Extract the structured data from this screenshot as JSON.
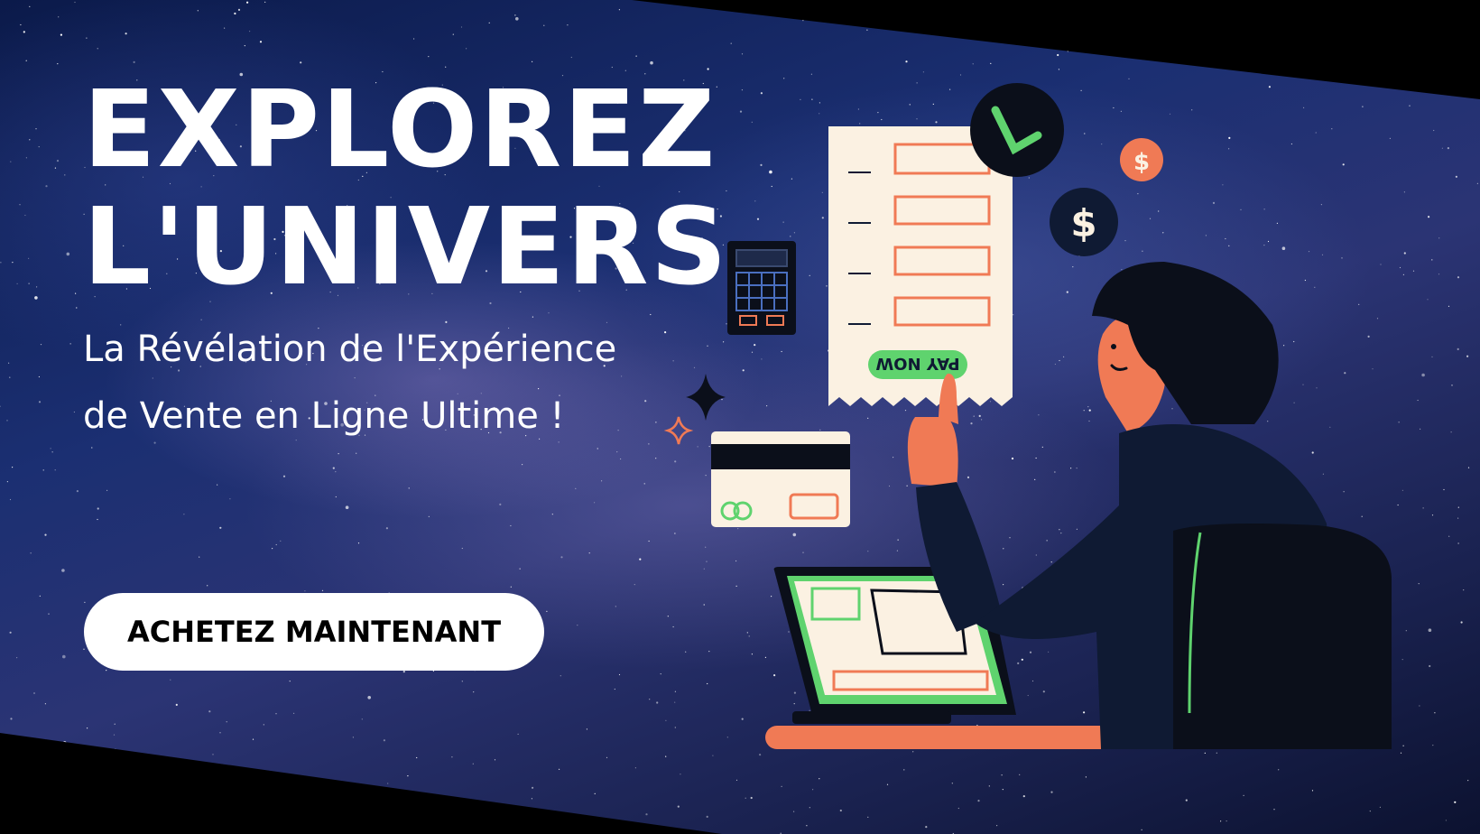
{
  "hero": {
    "title_line1": "EXPLOREZ",
    "title_line2": "L'UNIVERS",
    "subtitle_line1": "La Révélation de l'Expérience",
    "subtitle_line2": "de Vente en Ligne Ultime !",
    "cta_label": "ACHETEZ MAINTENANT"
  },
  "illustration": {
    "receipt_button_label": "PAY NOW",
    "icons": [
      "checkmark-icon",
      "dollar-coin-icon",
      "calculator-icon",
      "credit-card-icon",
      "sparkle-icon",
      "laptop-icon",
      "shopper-figure"
    ]
  },
  "colors": {
    "accent_orange": "#f07a55",
    "accent_green": "#5fd36e",
    "navy": "#0f1a33",
    "paper": "#fbf1e2"
  }
}
